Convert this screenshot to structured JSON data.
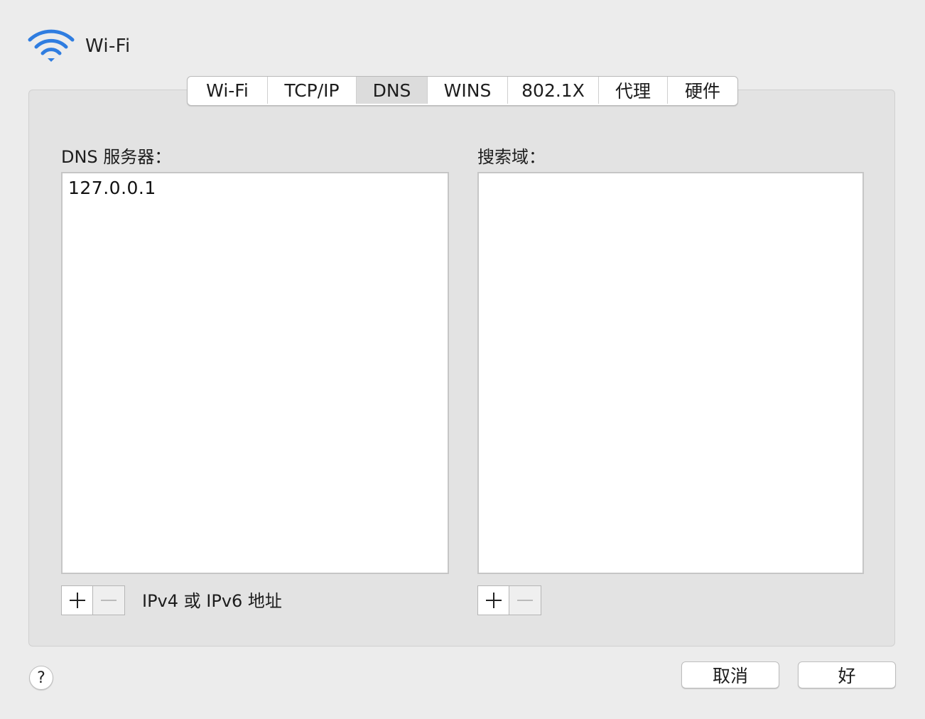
{
  "window": {
    "title": "Wi-Fi"
  },
  "tabs": [
    {
      "label": "Wi-Fi",
      "selected": false
    },
    {
      "label": "TCP/IP",
      "selected": false
    },
    {
      "label": "DNS",
      "selected": true
    },
    {
      "label": "WINS",
      "selected": false
    },
    {
      "label": "802.1X",
      "selected": false
    },
    {
      "label": "代理",
      "selected": false
    },
    {
      "label": "硬件",
      "selected": false
    }
  ],
  "dns_servers": {
    "label": "DNS 服务器：",
    "items": [
      "127.0.0.1"
    ],
    "hint": "IPv4 或 IPv6 地址",
    "add_icon": "plus-icon",
    "remove_icon": "minus-icon"
  },
  "search_domains": {
    "label": "搜索域：",
    "items": [],
    "add_icon": "plus-icon",
    "remove_icon": "minus-icon"
  },
  "footer": {
    "help_label": "?",
    "cancel_label": "取消",
    "ok_label": "好"
  },
  "colors": {
    "wifi_icon": "#2f7de0",
    "window_bg": "#ececec",
    "panel_bg": "#e3e3e3",
    "selected_tab_bg": "#dcdcdc"
  }
}
